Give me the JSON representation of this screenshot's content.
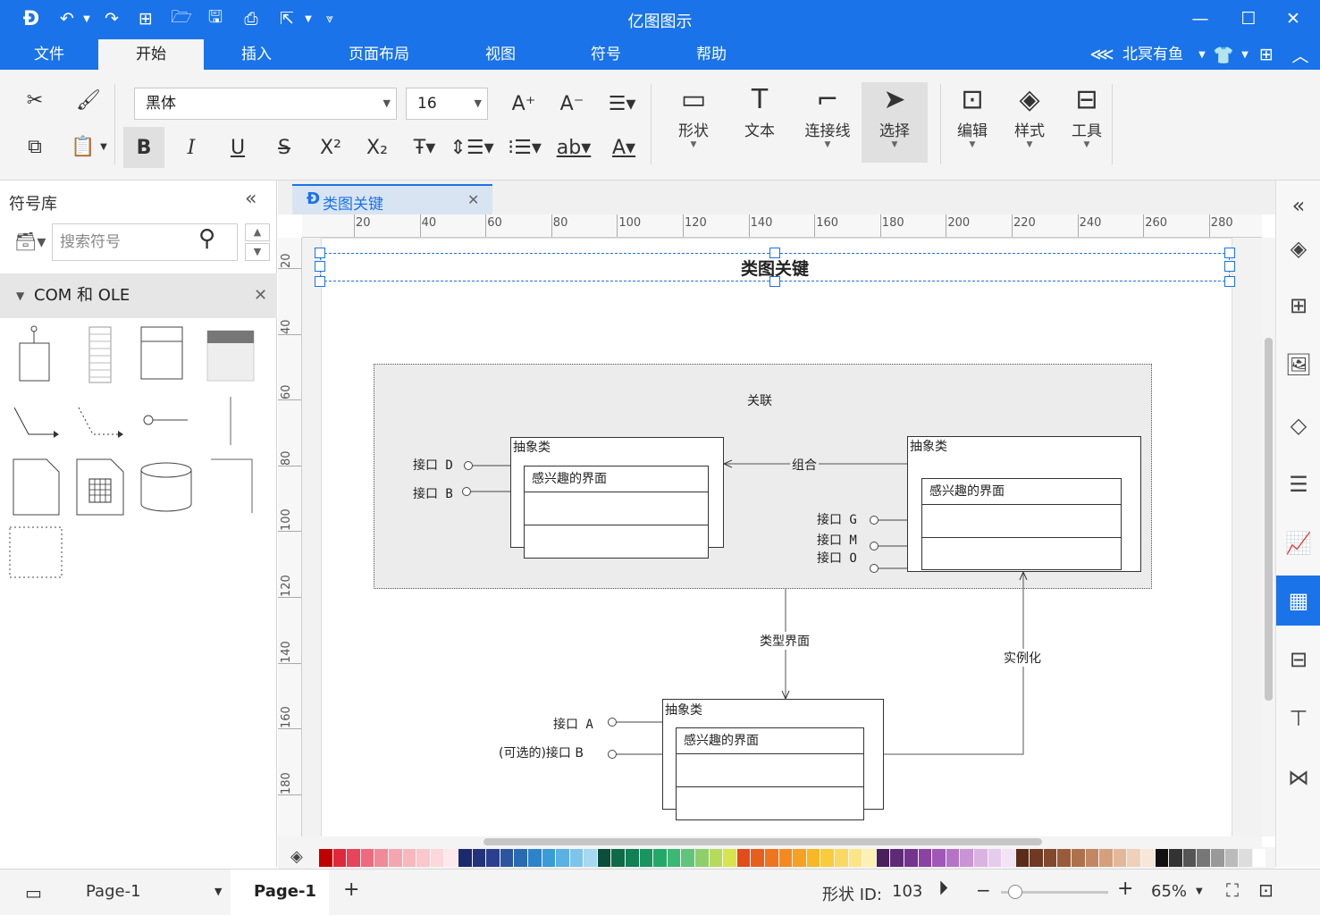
{
  "app": {
    "title": "亿图图示"
  },
  "menu": {
    "items": [
      "文件",
      "开始",
      "插入",
      "页面布局",
      "视图",
      "符号",
      "帮助"
    ],
    "active": "开始"
  },
  "account": {
    "username": "北冥有鱼"
  },
  "toolbar": {
    "font_name": "黑体",
    "font_size": "16",
    "shape_label": "形状",
    "text_label": "文本",
    "connector_label": "连接线",
    "select_label": "选择",
    "edit_label": "编辑",
    "style_label": "样式",
    "tools_label": "工具",
    "bold_glyph": "B",
    "italic_glyph": "I",
    "underline_glyph": "U",
    "strike_glyph": "S"
  },
  "library": {
    "title": "符号库",
    "search_placeholder": "搜索符号",
    "category": "COM 和 OLE"
  },
  "document": {
    "tab_name": "类图关键"
  },
  "ruler": {
    "h_ticks": [
      "20",
      "40",
      "60",
      "80",
      "100",
      "120",
      "140",
      "160",
      "180",
      "200",
      "220",
      "240",
      "260",
      "280"
    ],
    "v_ticks": [
      "20",
      "40",
      "60",
      "80",
      "100",
      "120",
      "140",
      "160",
      "180"
    ]
  },
  "diagram": {
    "title": "类图关键",
    "group_label": "关联",
    "class1": {
      "name": "抽象类",
      "interface": "感兴趣的界面",
      "ports": [
        "接口 D",
        "接口 B"
      ]
    },
    "class2": {
      "name": "抽象类",
      "interface": "感兴趣的界面",
      "ports": [
        "接口 G",
        "接口 M",
        "接口 O"
      ]
    },
    "class3": {
      "name": "抽象类",
      "interface": "感兴趣的界面",
      "ports": [
        "接口 A",
        "(可选的)接口 B"
      ]
    },
    "edge_composition": "组合",
    "edge_type_interface": "类型界面",
    "edge_instantiate": "实例化"
  },
  "palette": {
    "colors": [
      "#c00000",
      "#e0283c",
      "#e8445a",
      "#ee6a7e",
      "#f08a98",
      "#f4a6b0",
      "#f6b7bd",
      "#f8c8cc",
      "#fad8dc",
      "#fde9ec",
      "#1a2a6c",
      "#23337a",
      "#2c3f8f",
      "#2c55a0",
      "#2a6bb4",
      "#2d83c8",
      "#3a9bd9",
      "#5bb0e4",
      "#7cc4ec",
      "#a6d8f2",
      "#0b4f3a",
      "#0e6b4a",
      "#127f55",
      "#1a9560",
      "#24a86a",
      "#3bb874",
      "#62c47a",
      "#8ecf6c",
      "#b6da5c",
      "#d8e44e",
      "#e24b1a",
      "#e85f1c",
      "#ee741e",
      "#f38a20",
      "#f6a121",
      "#f8b823",
      "#f9cc3b",
      "#fbd960",
      "#fce586",
      "#fdf0b3",
      "#4a1f5c",
      "#5e2a75",
      "#73348d",
      "#8a42a3",
      "#9f58b7",
      "#b573c7",
      "#c994d5",
      "#dab3e2",
      "#e6ccec",
      "#f2e3f5",
      "#5a2d1a",
      "#6e3a22",
      "#83492c",
      "#995c3a",
      "#ae714c",
      "#c28762",
      "#d49f7c",
      "#e3b899",
      "#eed1b8",
      "#f6e7d8",
      "#111111",
      "#333333",
      "#555555",
      "#777777",
      "#999999",
      "#bbbbbb",
      "#dddddd",
      "#ffffff"
    ]
  },
  "status": {
    "page_selector": "Page-1",
    "page_tab": "Page-1",
    "shape_id_label": "形状 ID:",
    "shape_id_value": "103",
    "zoom": "65%",
    "zoom_fraction": 0.1
  }
}
